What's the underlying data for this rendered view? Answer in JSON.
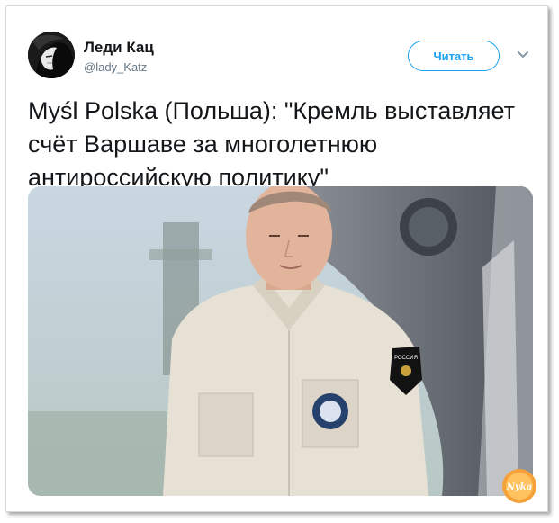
{
  "tweet": {
    "author_name": "Леди Кац",
    "author_handle": "@lady_Katz",
    "follow_label": "Читать",
    "text_lines": [
      "Myśl Polska (Польша): \"Кремль выставляет",
      "счёт Варшаве за многолетнюю",
      "антироссийскую политику\""
    ],
    "photo_badge_text": "РОССИЯ"
  },
  "watermark": {
    "text": "Nyka"
  },
  "colors": {
    "accent": "#1da1f2",
    "text": "#14171a",
    "muted": "#657786",
    "shirt": "#e7e1d5"
  },
  "icons": {
    "caret": "chevron-down-icon"
  }
}
